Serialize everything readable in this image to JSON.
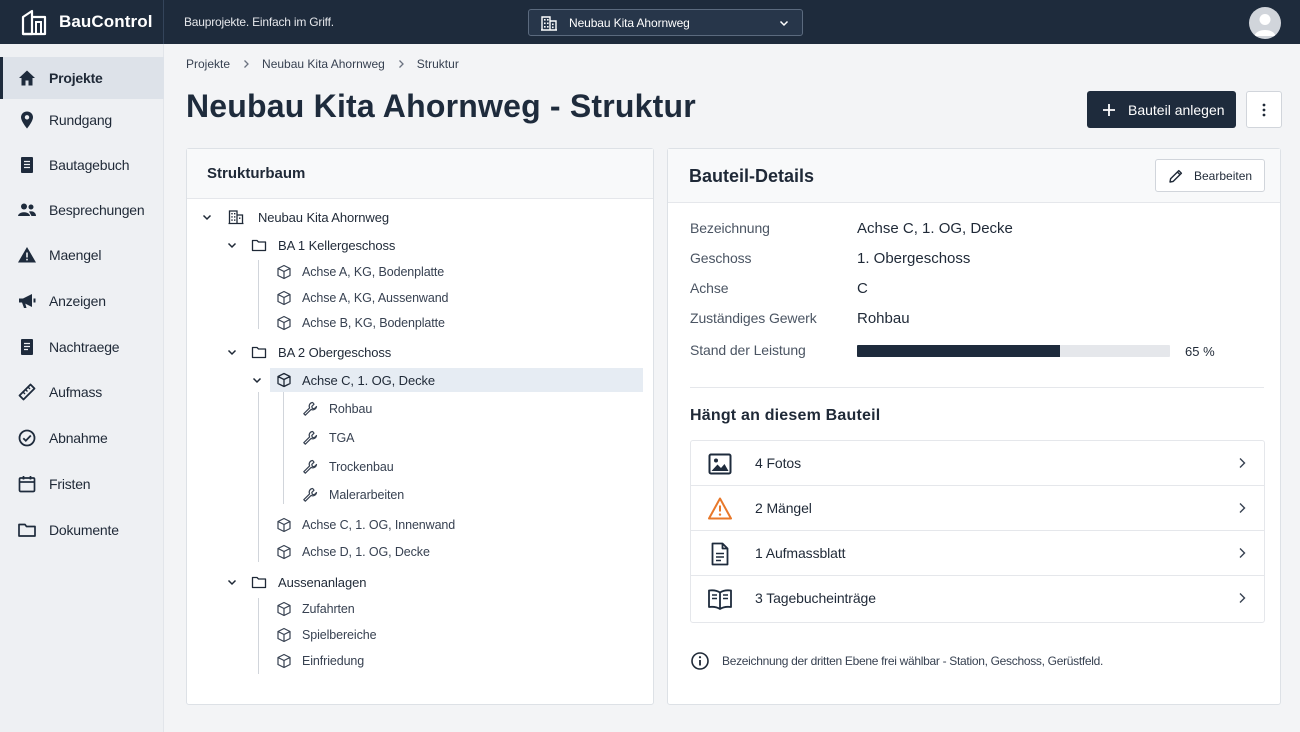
{
  "app": {
    "name": "BauControl",
    "tagline": "Bauprojekte. Einfach im Griff."
  },
  "project_selector": {
    "value": "Neubau Kita Ahornweg"
  },
  "sidebar": {
    "items": [
      {
        "label": "Projekte",
        "icon": "home-icon",
        "active": true
      },
      {
        "label": "Rundgang",
        "icon": "location-pin-icon"
      },
      {
        "label": "Bautagebuch",
        "icon": "document-icon"
      },
      {
        "label": "Besprechungen",
        "icon": "people-icon"
      },
      {
        "label": "Maengel",
        "icon": "warning-icon"
      },
      {
        "label": "Anzeigen",
        "icon": "megaphone-icon"
      },
      {
        "label": "Nachtraege",
        "icon": "document-icon"
      },
      {
        "label": "Aufmass",
        "icon": "ruler-icon"
      },
      {
        "label": "Abnahme",
        "icon": "check-circle-icon"
      },
      {
        "label": "Fristen",
        "icon": "calendar-icon"
      },
      {
        "label": "Dokumente",
        "icon": "folder-icon"
      }
    ]
  },
  "breadcrumb": [
    "Projekte",
    "Neubau Kita Ahornweg",
    "Struktur"
  ],
  "page": {
    "title": "Neubau Kita Ahornweg - Struktur"
  },
  "toolbar": {
    "add_label": "Bauteil anlegen"
  },
  "tree": {
    "title": "Strukturbaum",
    "nodes": [
      {
        "label": "Neubau Kita Ahornweg",
        "type": "building",
        "expanded": true
      },
      {
        "label": "BA 1 Kellergeschoss",
        "type": "folder",
        "expanded": true
      },
      {
        "label": "Achse A, KG, Bodenplatte",
        "type": "component"
      },
      {
        "label": "Achse A, KG, Aussenwand",
        "type": "component"
      },
      {
        "label": "Achse B, KG, Bodenplatte",
        "type": "component"
      },
      {
        "label": "BA 2 Obergeschoss",
        "type": "folder",
        "expanded": true
      },
      {
        "label": "Achse C, 1. OG, Decke",
        "type": "component",
        "expanded": true,
        "selected": true
      },
      {
        "label": "Rohbau",
        "type": "trade"
      },
      {
        "label": "TGA",
        "type": "trade"
      },
      {
        "label": "Trockenbau",
        "type": "trade"
      },
      {
        "label": "Malerarbeiten",
        "type": "trade"
      },
      {
        "label": "Achse C, 1. OG, Innenwand",
        "type": "component"
      },
      {
        "label": "Achse D, 1. OG, Decke",
        "type": "component"
      },
      {
        "label": "Aussenanlagen",
        "type": "folder",
        "expanded": true
      },
      {
        "label": "Zufahrten",
        "type": "component"
      },
      {
        "label": "Spielbereiche",
        "type": "component"
      },
      {
        "label": "Einfriedung",
        "type": "component"
      }
    ]
  },
  "details": {
    "title": "Bauteil-Details",
    "edit_label": "Bearbeiten",
    "fields": [
      {
        "label": "Bezeichnung",
        "value": "Achse C, 1. OG, Decke"
      },
      {
        "label": "Geschoss",
        "value": "1. Obergeschoss"
      },
      {
        "label": "Achse",
        "value": "C"
      },
      {
        "label": "Zuständiges Gewerk",
        "value": "Rohbau"
      }
    ],
    "progress": {
      "label": "Stand der Leistung",
      "percent": 65,
      "percent_text": "65 %"
    },
    "attached_title": "Hängt an diesem Bauteil",
    "attachments": [
      {
        "label": "4 Fotos",
        "icon": "image-icon"
      },
      {
        "label": "2 Mängel",
        "icon": "warning-triangle-icon",
        "color": "#e8782a"
      },
      {
        "label": "1 Aufmassblatt",
        "icon": "document-icon"
      },
      {
        "label": "3 Tagebucheinträge",
        "icon": "book-icon"
      }
    ],
    "hint": "Bezeichnung der dritten Ebene frei wählbar - Station, Geschoss, Gerüstfeld."
  },
  "colors": {
    "brand": "#1e2b3c",
    "warning": "#e8782a",
    "selection": "#e6ecf3"
  }
}
